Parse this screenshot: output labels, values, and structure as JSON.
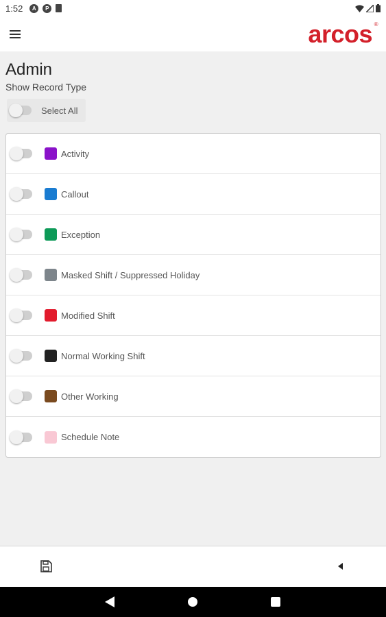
{
  "status_bar": {
    "time": "1:52",
    "notification_icons": [
      "A",
      "P"
    ]
  },
  "app_bar": {
    "logo_text": "arcos",
    "logo_mark": "®"
  },
  "page": {
    "title": "Admin",
    "subtitle": "Show Record Type",
    "select_all": {
      "label": "Select All",
      "checked": false
    }
  },
  "record_types": [
    {
      "label": "Activity",
      "color": "#8a12c9",
      "checked": false
    },
    {
      "label": "Callout",
      "color": "#1a7cd1",
      "checked": false
    },
    {
      "label": "Exception",
      "color": "#0d9a58",
      "checked": false
    },
    {
      "label": "Masked Shift / Suppressed Holiday",
      "color": "#7d858b",
      "checked": false
    },
    {
      "label": "Modified Shift",
      "color": "#e21b2d",
      "checked": false
    },
    {
      "label": "Normal Working Shift",
      "color": "#222222",
      "checked": false
    },
    {
      "label": "Other Working",
      "color": "#7a4a1f",
      "checked": false
    },
    {
      "label": "Schedule Note",
      "color": "#f9c8d4",
      "checked": false
    }
  ],
  "bottom_bar": {
    "icons": [
      "save-icon",
      "back-arrow-icon"
    ]
  },
  "colors": {
    "brand_red": "#d3202a",
    "background": "#f0f0f0"
  }
}
